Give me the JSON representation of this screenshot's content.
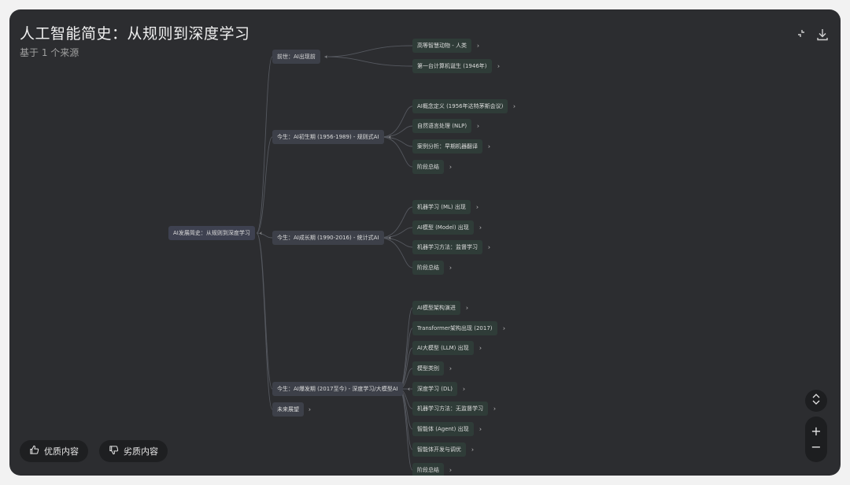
{
  "header": {
    "title": "人工智能简史：从规则到深度学习",
    "subtitle": "基于 1 个来源",
    "collapse_icon": "collapse-icon",
    "download_icon": "download-icon"
  },
  "mindmap": {
    "root": {
      "label": "AI发展简史：从规则到深度学习",
      "toggle": "‹"
    },
    "branches": [
      {
        "label": "前世：AI出现前",
        "toggle": "‹"
      },
      {
        "label": "今生：AI初生期 (1956-1989) - 规则式AI",
        "toggle": "‹"
      },
      {
        "label": "今生：AI成长期 (1990-2016) - 统计式AI",
        "toggle": "‹"
      },
      {
        "label": "今生：AI爆发期 (2017至今) - 深度学习/大模型AI",
        "toggle": "‹"
      },
      {
        "label": "未来展望",
        "toggle": "›"
      }
    ],
    "leaves": [
      {
        "label": "高等智慧动物 - 人类",
        "toggle": "›"
      },
      {
        "label": "第一台计算机诞生 (1946年)",
        "toggle": "›"
      },
      {
        "label": "AI概念定义 (1956年达特茅斯会议)",
        "toggle": "›"
      },
      {
        "label": "自然语言处理 (NLP)",
        "toggle": "›"
      },
      {
        "label": "案例分析：早期机器翻译",
        "toggle": "›"
      },
      {
        "label": "阶段总结",
        "toggle": "›"
      },
      {
        "label": "机器学习 (ML) 出现",
        "toggle": "›"
      },
      {
        "label": "AI模型 (Model) 出现",
        "toggle": "›"
      },
      {
        "label": "机器学习方法：监督学习",
        "toggle": "›"
      },
      {
        "label": "阶段总结",
        "toggle": "›"
      },
      {
        "label": "AI模型架构演进",
        "toggle": "›"
      },
      {
        "label": "Transformer架构出现 (2017)",
        "toggle": "›"
      },
      {
        "label": "AI大模型 (LLM) 出现",
        "toggle": "›"
      },
      {
        "label": "模型类别",
        "toggle": "›"
      },
      {
        "label": "深度学习 (DL)",
        "toggle": "›"
      },
      {
        "label": "机器学习方法：无监督学习",
        "toggle": "›"
      },
      {
        "label": "智能体 (Agent) 出现",
        "toggle": "›"
      },
      {
        "label": "智能体开发与调优",
        "toggle": "›"
      },
      {
        "label": "阶段总结",
        "toggle": "›"
      }
    ]
  },
  "feedback": {
    "good_label": "优质内容",
    "bad_label": "劣质内容",
    "good_icon": "thumbs-up-icon",
    "bad_icon": "thumbs-down-icon"
  },
  "controls": {
    "expand_icon": "chevron-up-down-icon",
    "zoom_in": "+",
    "zoom_out": "−"
  },
  "colors": {
    "background": "#2c2d30",
    "root_node": "#3e4150",
    "branch_node": "#3d4049",
    "leaf_node": "#2f3c38",
    "edge": "#55585f"
  }
}
